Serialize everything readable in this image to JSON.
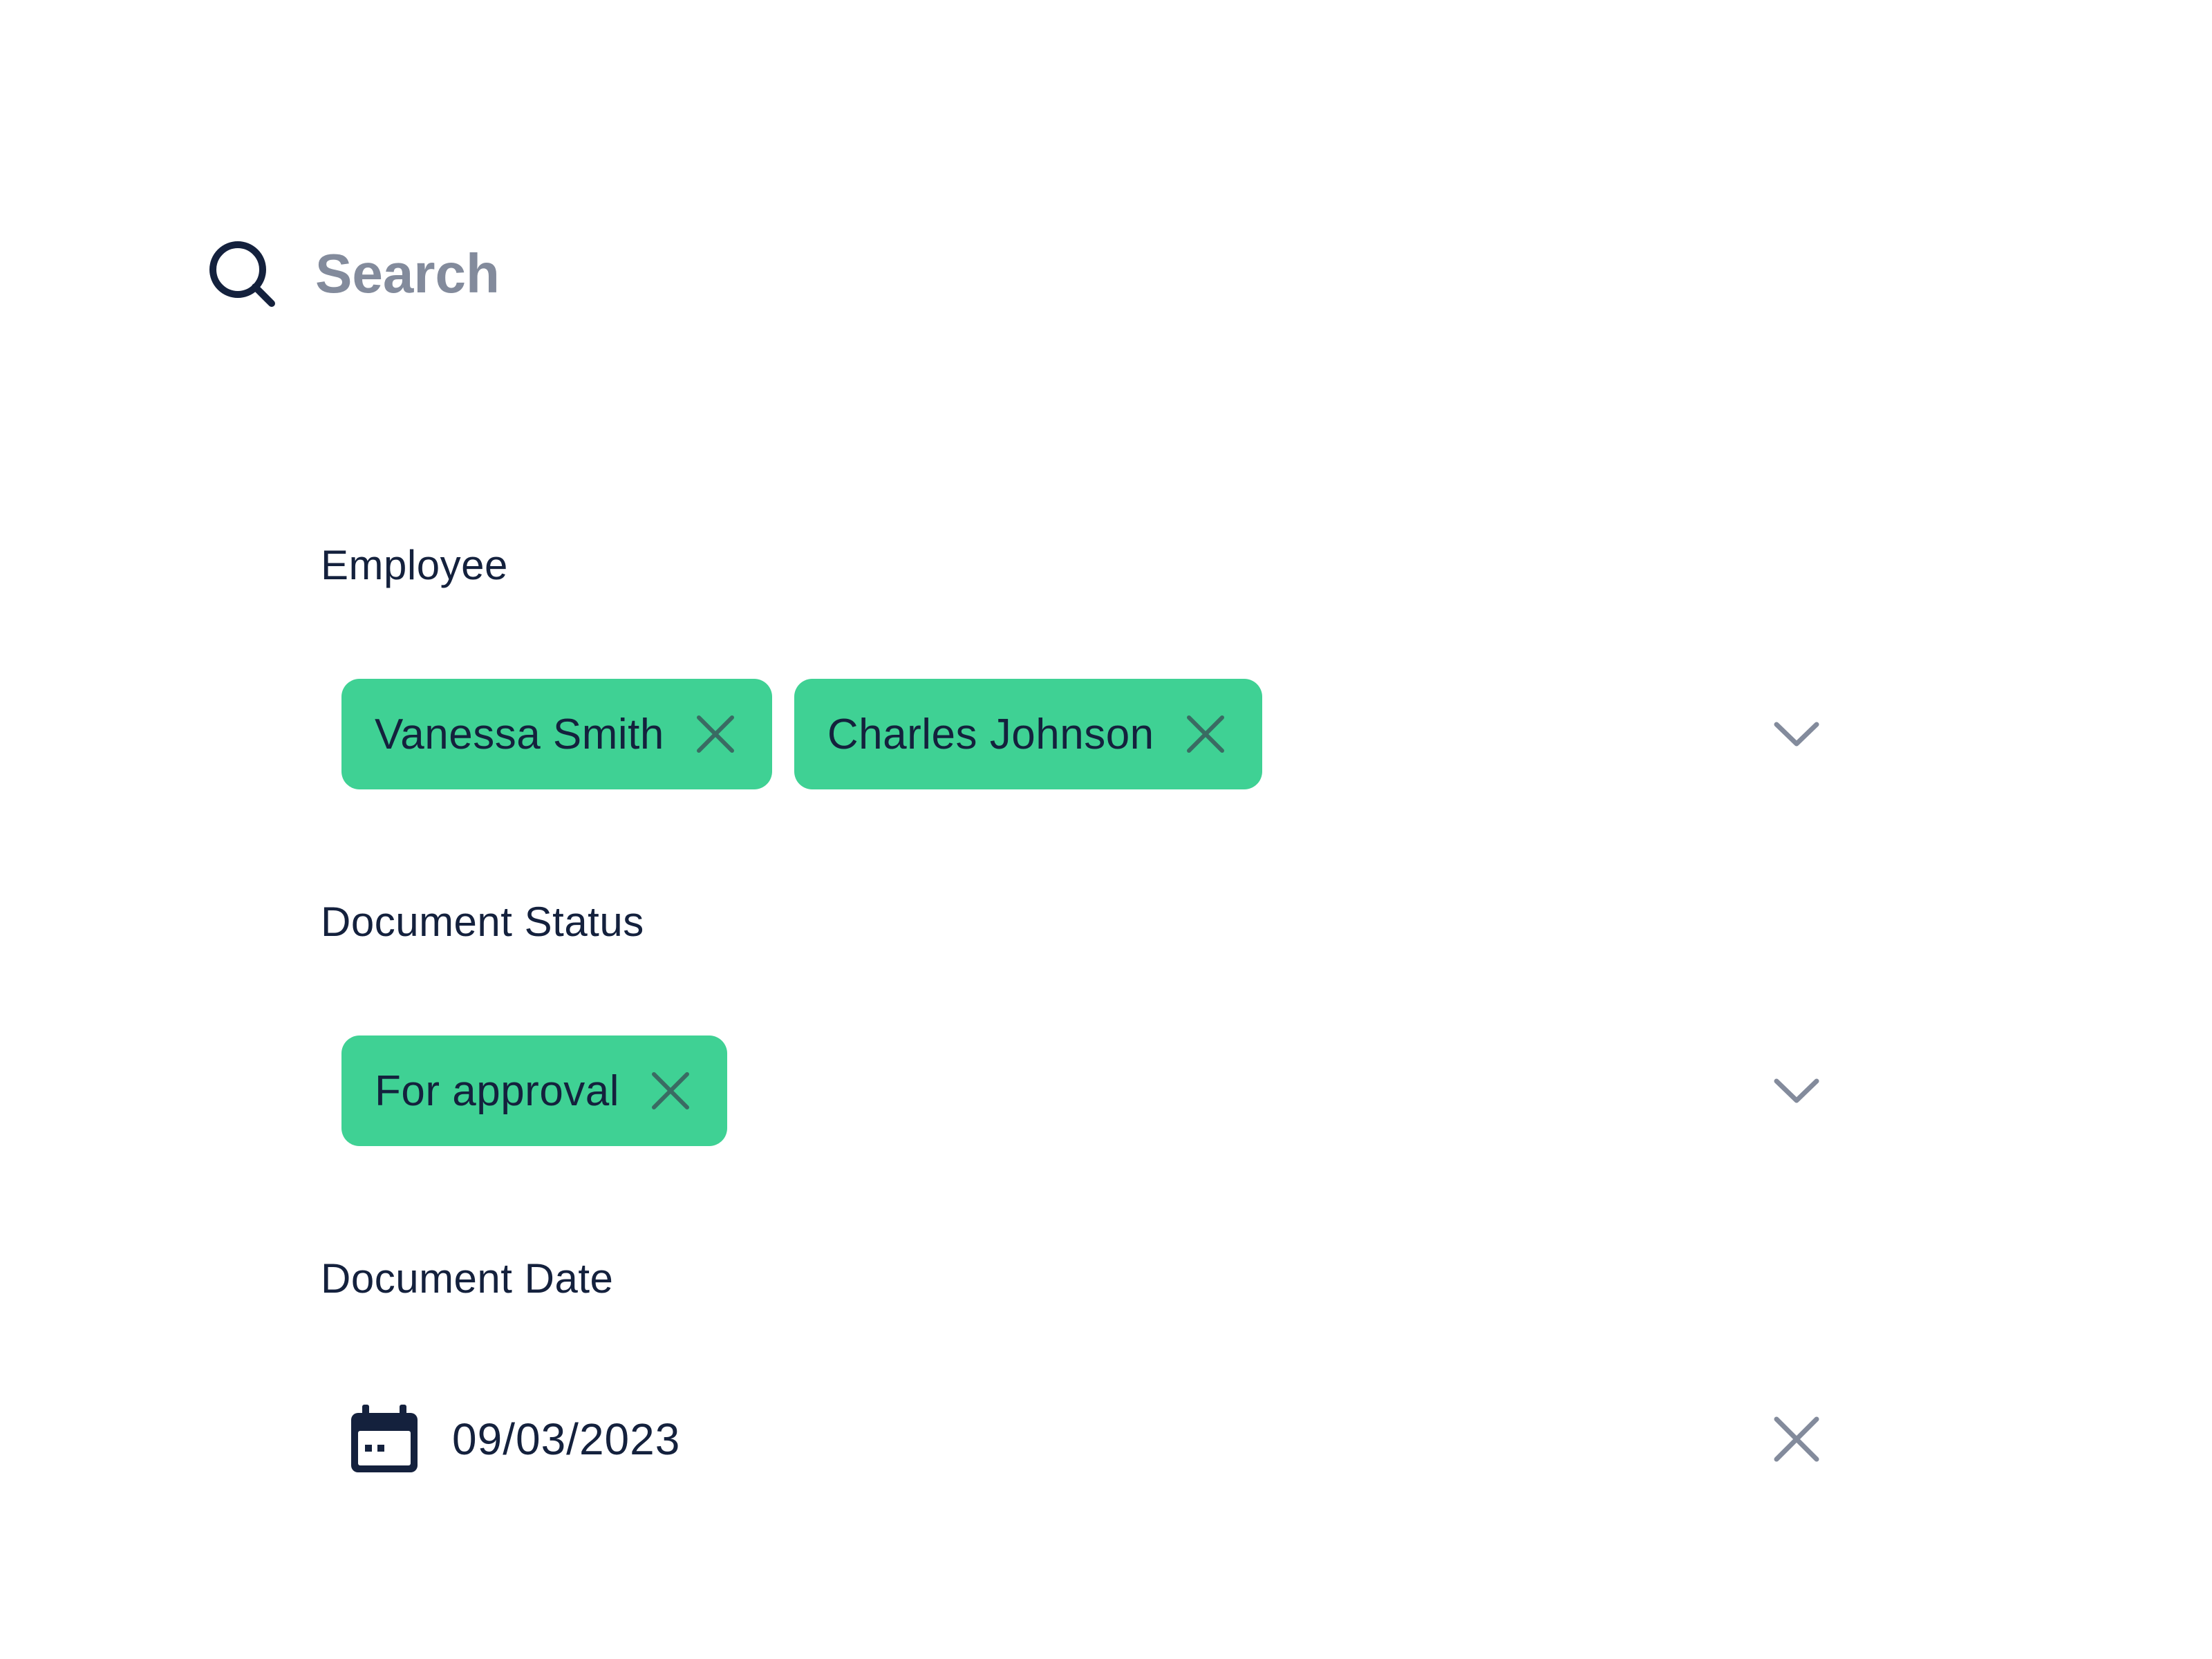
{
  "search": {
    "placeholder": "Search",
    "value": ""
  },
  "filters": {
    "employee": {
      "label": "Employee",
      "chips": [
        {
          "label": "Vanessa Smith"
        },
        {
          "label": "Charles Johnson"
        }
      ]
    },
    "document_status": {
      "label": "Document Status",
      "chips": [
        {
          "label": "For approval"
        }
      ]
    },
    "document_date": {
      "label": "Document Date",
      "value": "09/03/2023"
    }
  },
  "icons": {
    "search": "search-icon",
    "chip_remove": "close-icon",
    "dropdown": "chevron-down-icon",
    "calendar": "calendar-icon",
    "clear": "close-icon"
  },
  "colors": {
    "chip_background": "#3fd194",
    "text_primary": "#14213d",
    "text_muted": "#838b9c",
    "chip_remove_icon": "#3a6b63"
  }
}
